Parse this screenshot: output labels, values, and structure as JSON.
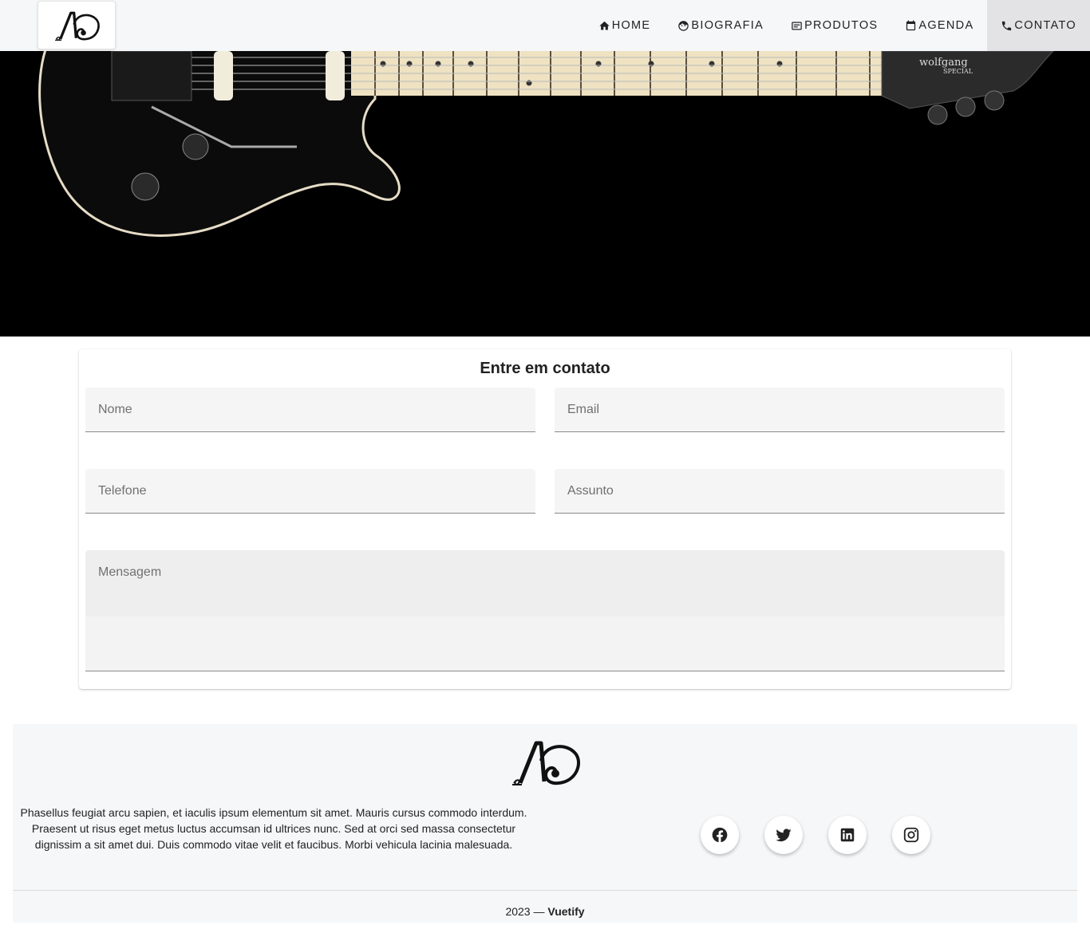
{
  "nav": {
    "items": [
      {
        "label": "HOME",
        "icon": "home-icon"
      },
      {
        "label": "BIOGRAFIA",
        "icon": "face-icon"
      },
      {
        "label": "PRODUTOS",
        "icon": "card-icon"
      },
      {
        "label": "AGENDA",
        "icon": "calendar-icon"
      },
      {
        "label": "CONTATO",
        "icon": "phone-icon",
        "active": true
      }
    ]
  },
  "hero": {
    "headstock_brand": "wolfgang",
    "headstock_model": "SPECIAL"
  },
  "form": {
    "title": "Entre em contato",
    "fields": {
      "nome": "Nome",
      "email": "Email",
      "telefone": "Telefone",
      "assunto": "Assunto",
      "mensagem": "Mensagem"
    }
  },
  "footer": {
    "description": "Phasellus feugiat arcu sapien, et iaculis ipsum elementum sit amet. Mauris cursus commodo interdum. Praesent ut risus eget metus luctus accumsan id ultrices nunc. Sed at orci sed massa consectetur dignissim a sit amet dui. Duis commodo vitae velit et faucibus. Morbi vehicula lacinia malesuada.",
    "socials": [
      "facebook-icon",
      "twitter-icon",
      "linkedin-icon",
      "instagram-icon"
    ],
    "year": "2023 — ",
    "brand": "Vuetify"
  }
}
